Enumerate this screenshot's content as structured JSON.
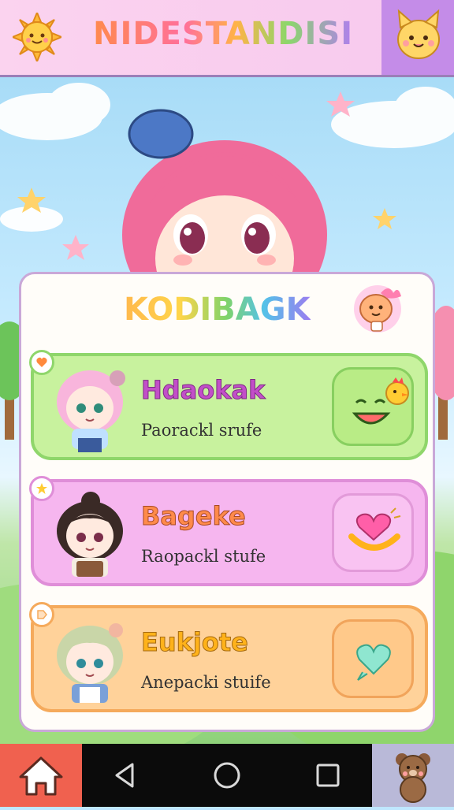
{
  "app": {
    "title": "NIDESTANDISI"
  },
  "panel": {
    "title": "KODIBAGK"
  },
  "cards": [
    {
      "name": "Hdaokak",
      "subtitle": "Paorackl srufe",
      "badge_icon": "heart-icon",
      "action_icon": "smile-chick-icon",
      "color": "#c8f29e"
    },
    {
      "name": "Bageke",
      "subtitle": "Raopackl stufe",
      "badge_icon": "star-icon",
      "action_icon": "heart-bowl-icon",
      "color": "#f6b6ef"
    },
    {
      "name": "Eukjote",
      "subtitle": "Anepacki stuife",
      "badge_icon": "tag-icon",
      "action_icon": "heart-bubble-icon",
      "color": "#ffd29a"
    }
  ],
  "navbar": {
    "items": [
      "home-icon",
      "back-icon",
      "circle-home-icon",
      "recents-icon",
      "pet-icon"
    ]
  },
  "colors": {
    "header": "#f7c9ee",
    "accent": "#c48ce8",
    "home": "#f0614f"
  }
}
